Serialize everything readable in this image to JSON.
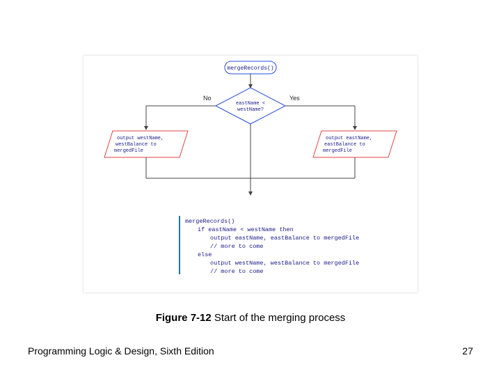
{
  "figure": {
    "caption_prefix": "Figure 7-12",
    "caption_rest": " Start of the merging process"
  },
  "footer": {
    "left": "Programming Logic & Design, Sixth Edition",
    "right": "27"
  },
  "flow": {
    "terminal": "mergeRecords()",
    "decision_l1": "eastName <",
    "decision_l2": "westName?",
    "yes": "Yes",
    "no": "No",
    "left_box_l1": "output westName,",
    "left_box_l2": "westBalance to",
    "left_box_l3": "mergedFile",
    "right_box_l1": "output eastName,",
    "right_box_l2": "eastBalance to",
    "right_box_l3": "mergedFile"
  },
  "pseudo": {
    "l1": "mergeRecords()",
    "l2": "if eastName < westName then",
    "l3": "output eastName, eastBalance to mergedFile",
    "l4": "// more to come",
    "l5": "else",
    "l6": "output westName, westBalance to mergedFile",
    "l7": "// more to come"
  }
}
